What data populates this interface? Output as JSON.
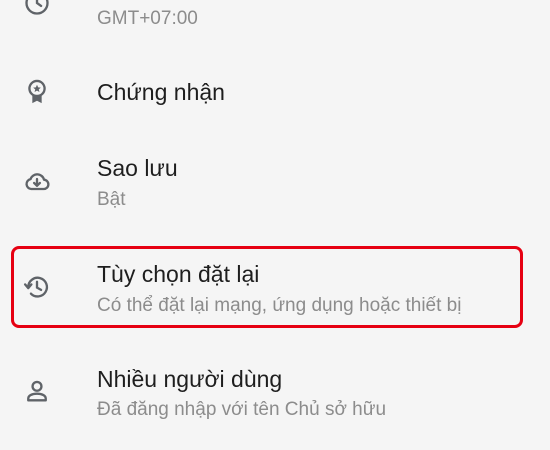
{
  "settings": {
    "items": [
      {
        "id": "date-time",
        "title": "",
        "subtitle": "GMT+07:00",
        "icon": "clock-icon"
      },
      {
        "id": "certificates",
        "title": "Chứng nhận",
        "subtitle": "",
        "icon": "badge-icon"
      },
      {
        "id": "backup",
        "title": "Sao lưu",
        "subtitle": "Bật",
        "icon": "cloud-download-icon"
      },
      {
        "id": "reset-options",
        "title": "Tùy chọn đặt lại",
        "subtitle": "Có thể đặt lại mạng, ứng dụng hoặc thiết bị",
        "icon": "history-icon"
      },
      {
        "id": "multiple-users",
        "title": "Nhiều người dùng",
        "subtitle": "Đã đăng nhập với tên Chủ sở hữu",
        "icon": "person-icon"
      }
    ]
  },
  "colors": {
    "background": "#f5f5f5",
    "title_text": "#1e1e1e",
    "subtitle_text": "#8c8c8c",
    "icon": "#5f6368",
    "highlight_border": "#e60012"
  }
}
